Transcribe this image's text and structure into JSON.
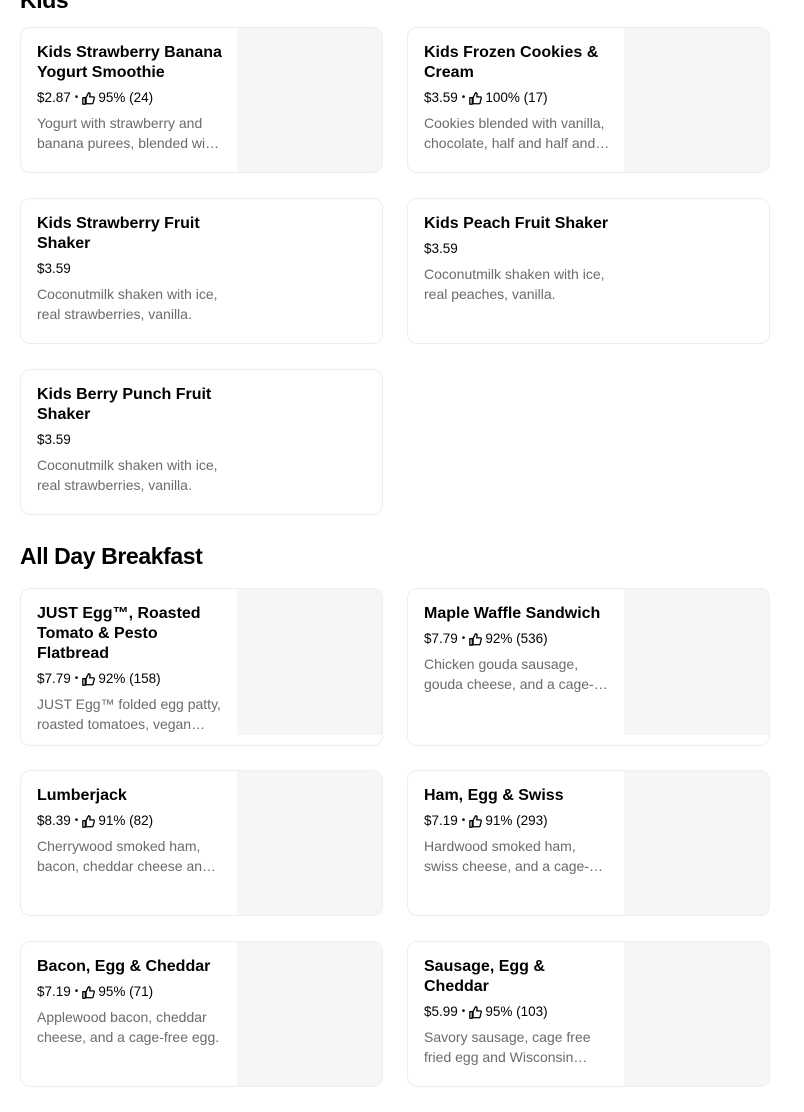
{
  "sections": [
    {
      "title": "Kids",
      "items": [
        {
          "name": "Kids Strawberry Banana Yogurt Smoothie",
          "price": "$2.87",
          "rating": "95% (24)",
          "description": "Yogurt with strawberry and banana purees, blended with ice."
        },
        {
          "name": "Kids Frozen Cookies & Cream",
          "price": "$3.59",
          "rating": "100% (17)",
          "description": "Cookies blended with vanilla, chocolate, half and half and ice."
        },
        {
          "name": "Kids Strawberry Fruit Shaker",
          "price": "$3.59",
          "rating": "",
          "description": "Coconutmilk shaken with ice, real strawberries, vanilla."
        },
        {
          "name": "Kids Peach Fruit Shaker",
          "price": "$3.59",
          "rating": "",
          "description": "Coconutmilk shaken with ice, real peaches, vanilla."
        },
        {
          "name": "Kids Berry Punch Fruit Shaker",
          "price": "$3.59",
          "rating": "",
          "description": "Coconutmilk shaken with ice, real strawberries, vanilla."
        }
      ]
    },
    {
      "title": "All Day Breakfast",
      "items": [
        {
          "name": "JUST Egg™, Roasted Tomato & Pesto Flatbread",
          "price": "$7.79",
          "rating": "92% (158)",
          "description": "JUST Egg™ folded egg patty, roasted tomatoes, vegan pesto."
        },
        {
          "name": "Maple Waffle Sandwich",
          "price": "$7.79",
          "rating": "92% (536)",
          "description": "Chicken gouda sausage, gouda cheese, and a cage-free egg."
        },
        {
          "name": "Lumberjack",
          "price": "$8.39",
          "rating": "91% (82)",
          "description": "Cherrywood smoked ham, bacon, cheddar cheese and egg."
        },
        {
          "name": "Ham, Egg & Swiss",
          "price": "$7.19",
          "rating": "91% (293)",
          "description": "Hardwood smoked ham, swiss cheese, and a cage-free egg."
        },
        {
          "name": "Bacon, Egg & Cheddar",
          "price": "$7.19",
          "rating": "95% (71)",
          "description": "Applewood bacon, cheddar cheese, and a cage-free egg."
        },
        {
          "name": "Sausage, Egg & Cheddar",
          "price": "$5.99",
          "rating": "95% (103)",
          "description": "Savory sausage, cage free fried egg and Wisconsin cheddar."
        }
      ]
    }
  ]
}
